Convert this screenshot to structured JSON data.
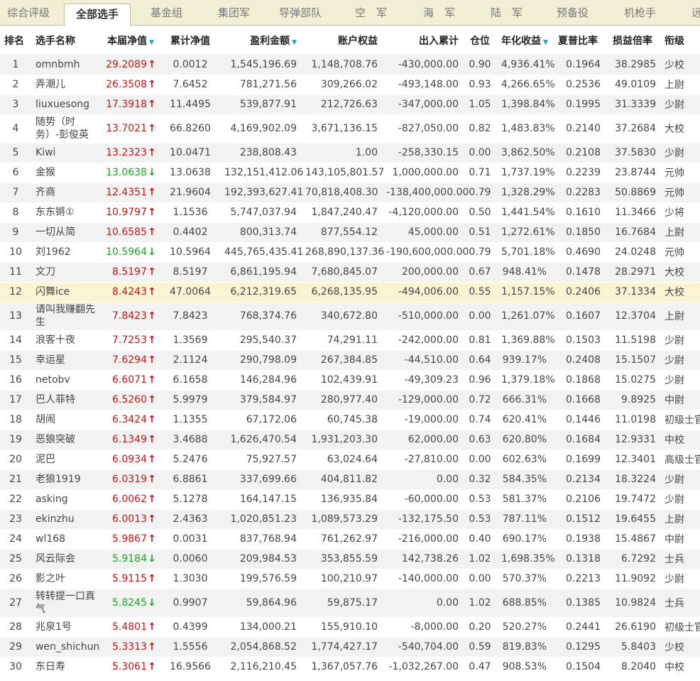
{
  "tabs": [
    "综合评级",
    "全部选手",
    "基金组",
    "集团军",
    "导弹部队",
    "空　军",
    "海　军",
    "陆　军",
    "预备役",
    "机枪手",
    "远"
  ],
  "columns": [
    "排名",
    "选手名称",
    "本届净值",
    "累计净值",
    "盈利金额",
    "账户权益",
    "出入累计",
    "仓位",
    "年化收益",
    "夏普比率",
    "损益倍率",
    "衔级"
  ],
  "rows": [
    {
      "rank": "1",
      "name": "omnbmh",
      "nav": "29.2089",
      "dir": "up",
      "cum": "0.0012",
      "profit": "1,545,196.69",
      "equity": "1,148,708.76",
      "flow": "-430,000.00",
      "pos": "0.90",
      "annual": "4,936.41%",
      "sharpe": "0.1964",
      "ratio": "38.2985",
      "grade": "少校"
    },
    {
      "rank": "2",
      "name": "弄潮儿",
      "nav": "26.3508",
      "dir": "up",
      "cum": "7.6452",
      "profit": "781,271.56",
      "equity": "309,266.02",
      "flow": "-493,148.00",
      "pos": "0.93",
      "annual": "4,266.65%",
      "sharpe": "0.2536",
      "ratio": "49.0109",
      "grade": "上尉"
    },
    {
      "rank": "3",
      "name": "liuxuesong",
      "nav": "17.3918",
      "dir": "up",
      "cum": "11.4495",
      "profit": "539,877.91",
      "equity": "212,726.63",
      "flow": "-347,000.00",
      "pos": "1.05",
      "annual": "1,398.84%",
      "sharpe": "0.1995",
      "ratio": "31.3339",
      "grade": "少尉"
    },
    {
      "rank": "4",
      "name": "随势（时务）-彭俊英",
      "nav": "13.7021",
      "dir": "up",
      "cum": "66.8260",
      "profit": "4,169,902.09",
      "equity": "3,671,136.15",
      "flow": "-827,050.00",
      "pos": "0.82",
      "annual": "1,483.83%",
      "sharpe": "0.2140",
      "ratio": "37.2684",
      "grade": "大校"
    },
    {
      "rank": "5",
      "name": "Kiwi",
      "nav": "13.2323",
      "dir": "up",
      "cum": "10.0471",
      "profit": "238,808.43",
      "equity": "1.00",
      "flow": "-258,330.15",
      "pos": "0.00",
      "annual": "3,862.50%",
      "sharpe": "0.2108",
      "ratio": "37.5830",
      "grade": "少尉"
    },
    {
      "rank": "6",
      "name": "金猴",
      "nav": "13.0638",
      "dir": "down",
      "cum": "13.0638",
      "profit": "132,151,412.06",
      "equity": "143,105,801.57",
      "flow": "1,000,000.00",
      "pos": "0.71",
      "annual": "1,737.19%",
      "sharpe": "0.2239",
      "ratio": "23.8744",
      "grade": "元帅"
    },
    {
      "rank": "7",
      "name": "齐商",
      "nav": "12.4351",
      "dir": "up",
      "cum": "21.9604",
      "profit": "192,393,627.41",
      "equity": "70,818,408.30",
      "flow": "-138,400,000.00",
      "pos": "0.79",
      "annual": "1,328.29%",
      "sharpe": "0.2283",
      "ratio": "50.8869",
      "grade": "元帅"
    },
    {
      "rank": "8",
      "name": "东东锵①",
      "nav": "10.9797",
      "dir": "up",
      "cum": "1.1536",
      "profit": "5,747,037.94",
      "equity": "1,847,240.47",
      "flow": "-4,120,000.00",
      "pos": "0.50",
      "annual": "1,441.54%",
      "sharpe": "0.1610",
      "ratio": "11.3466",
      "grade": "少将"
    },
    {
      "rank": "9",
      "name": "一切从简",
      "nav": "10.6585",
      "dir": "up",
      "cum": "0.4402",
      "profit": "800,313.74",
      "equity": "877,554.12",
      "flow": "45,000.00",
      "pos": "0.51",
      "annual": "1,272.61%",
      "sharpe": "0.1850",
      "ratio": "16.7684",
      "grade": "上尉"
    },
    {
      "rank": "10",
      "name": "刘1962",
      "nav": "10.5964",
      "dir": "down",
      "cum": "10.5964",
      "profit": "445,765,435.41",
      "equity": "268,890,137.36",
      "flow": "-190,600,000.00",
      "pos": "0.79",
      "annual": "5,701.18%",
      "sharpe": "0.4690",
      "ratio": "24.0248",
      "grade": "元帅"
    },
    {
      "rank": "11",
      "name": "文刀",
      "nav": "8.5197",
      "dir": "up",
      "cum": "8.5197",
      "profit": "6,861,195.94",
      "equity": "7,680,845.07",
      "flow": "200,000.00",
      "pos": "0.67",
      "annual": "948.41%",
      "sharpe": "0.1478",
      "ratio": "28.2971",
      "grade": "大校"
    },
    {
      "rank": "12",
      "name": "闪舞ice",
      "nav": "8.4243",
      "dir": "up",
      "cum": "47.0064",
      "profit": "6,212,319.65",
      "equity": "6,268,135.95",
      "flow": "-494,006.00",
      "pos": "0.55",
      "annual": "1,157.15%",
      "sharpe": "0.2406",
      "ratio": "37.1334",
      "grade": "大校"
    },
    {
      "rank": "13",
      "name": "请叫我赚翻先生",
      "nav": "7.8423",
      "dir": "up",
      "cum": "7.8423",
      "profit": "768,374.76",
      "equity": "340,672.80",
      "flow": "-510,000.00",
      "pos": "0.00",
      "annual": "1,261.07%",
      "sharpe": "0.1607",
      "ratio": "12.3704",
      "grade": "上尉"
    },
    {
      "rank": "14",
      "name": "浪客十夜",
      "nav": "7.7253",
      "dir": "up",
      "cum": "1.3569",
      "profit": "295,540.37",
      "equity": "74,291.11",
      "flow": "-242,000.00",
      "pos": "0.81",
      "annual": "1,369.88%",
      "sharpe": "0.1503",
      "ratio": "11.5198",
      "grade": "少尉"
    },
    {
      "rank": "15",
      "name": "幸运星",
      "nav": "7.6294",
      "dir": "up",
      "cum": "2.1124",
      "profit": "290,798.09",
      "equity": "267,384.85",
      "flow": "-44,510.00",
      "pos": "0.64",
      "annual": "939.17%",
      "sharpe": "0.2408",
      "ratio": "15.1507",
      "grade": "少尉"
    },
    {
      "rank": "16",
      "name": "netobv",
      "nav": "6.6071",
      "dir": "up",
      "cum": "6.1658",
      "profit": "146,284.96",
      "equity": "102,439.91",
      "flow": "-49,309.23",
      "pos": "0.96",
      "annual": "1,379.18%",
      "sharpe": "0.1868",
      "ratio": "15.0275",
      "grade": "少尉"
    },
    {
      "rank": "17",
      "name": "巴人菲特",
      "nav": "6.5260",
      "dir": "up",
      "cum": "5.9979",
      "profit": "379,584.97",
      "equity": "280,977.40",
      "flow": "-129,000.00",
      "pos": "0.72",
      "annual": "666.31%",
      "sharpe": "0.1668",
      "ratio": "9.8925",
      "grade": "中尉"
    },
    {
      "rank": "18",
      "name": "胡闹",
      "nav": "6.3424",
      "dir": "up",
      "cum": "1.1355",
      "profit": "67,172.06",
      "equity": "60,745.38",
      "flow": "-19,000.00",
      "pos": "0.74",
      "annual": "620.41%",
      "sharpe": "0.1446",
      "ratio": "11.0198",
      "grade": "初级士官"
    },
    {
      "rank": "19",
      "name": "恶狼突破",
      "nav": "6.1349",
      "dir": "up",
      "cum": "3.4688",
      "profit": "1,626,470.54",
      "equity": "1,931,203.30",
      "flow": "62,000.00",
      "pos": "0.63",
      "annual": "620.80%",
      "sharpe": "0.1684",
      "ratio": "12.9331",
      "grade": "中校"
    },
    {
      "rank": "20",
      "name": "泥巴",
      "nav": "6.0934",
      "dir": "up",
      "cum": "5.2476",
      "profit": "75,927.57",
      "equity": "63,024.64",
      "flow": "-27,810.00",
      "pos": "0.00",
      "annual": "602.63%",
      "sharpe": "0.1699",
      "ratio": "12.3401",
      "grade": "高级士官"
    },
    {
      "rank": "21",
      "name": "老狼1919",
      "nav": "6.0319",
      "dir": "up",
      "cum": "6.8861",
      "profit": "337,699.66",
      "equity": "404,811.82",
      "flow": "0.00",
      "pos": "0.32",
      "annual": "584.35%",
      "sharpe": "0.2134",
      "ratio": "18.3224",
      "grade": "少尉"
    },
    {
      "rank": "22",
      "name": "asking",
      "nav": "6.0062",
      "dir": "up",
      "cum": "5.1278",
      "profit": "164,147.15",
      "equity": "136,935.84",
      "flow": "-60,000.00",
      "pos": "0.53",
      "annual": "581.37%",
      "sharpe": "0.2106",
      "ratio": "19.7472",
      "grade": "少尉"
    },
    {
      "rank": "23",
      "name": "ekinzhu",
      "nav": "6.0013",
      "dir": "up",
      "cum": "2.4363",
      "profit": "1,020,851.23",
      "equity": "1,089,573.29",
      "flow": "-132,175.50",
      "pos": "0.53",
      "annual": "787.11%",
      "sharpe": "0.1512",
      "ratio": "19.6455",
      "grade": "上尉"
    },
    {
      "rank": "24",
      "name": "wl168",
      "nav": "5.9867",
      "dir": "up",
      "cum": "0.0031",
      "profit": "837,768.94",
      "equity": "761,262.97",
      "flow": "-216,000.00",
      "pos": "0.40",
      "annual": "690.17%",
      "sharpe": "0.1938",
      "ratio": "15.4867",
      "grade": "中尉"
    },
    {
      "rank": "25",
      "name": "风云际会",
      "nav": "5.9184",
      "dir": "down",
      "cum": "0.0060",
      "profit": "209,984.53",
      "equity": "353,855.59",
      "flow": "142,738.26",
      "pos": "1.02",
      "annual": "1,698.35%",
      "sharpe": "0.1318",
      "ratio": "6.7292",
      "grade": "士兵"
    },
    {
      "rank": "26",
      "name": "影之叶",
      "nav": "5.9115",
      "dir": "up",
      "cum": "1.3030",
      "profit": "199,576.59",
      "equity": "100,210.97",
      "flow": "-140,000.00",
      "pos": "0.00",
      "annual": "570.37%",
      "sharpe": "0.2213",
      "ratio": "11.9092",
      "grade": "少尉"
    },
    {
      "rank": "27",
      "name": "转转提一口真气",
      "nav": "5.8245",
      "dir": "down",
      "cum": "0.9907",
      "profit": "59,864.96",
      "equity": "59,875.17",
      "flow": "0.00",
      "pos": "1.02",
      "annual": "688.85%",
      "sharpe": "0.1385",
      "ratio": "10.9824",
      "grade": "士兵"
    },
    {
      "rank": "28",
      "name": "兆泉1号",
      "nav": "5.4801",
      "dir": "up",
      "cum": "0.4399",
      "profit": "134,000.21",
      "equity": "155,910.10",
      "flow": "-8,000.00",
      "pos": "0.20",
      "annual": "520.27%",
      "sharpe": "0.2441",
      "ratio": "26.6190",
      "grade": "初级士官"
    },
    {
      "rank": "29",
      "name": "wen_shichun",
      "nav": "5.3313",
      "dir": "up",
      "cum": "1.5556",
      "profit": "2,054,868.52",
      "equity": "1,774,427.17",
      "flow": "-540,704.00",
      "pos": "0.59",
      "annual": "819.83%",
      "sharpe": "0.1295",
      "ratio": "5.8403",
      "grade": "少校"
    },
    {
      "rank": "30",
      "name": "东日寿",
      "nav": "5.3061",
      "dir": "up",
      "cum": "16.9566",
      "profit": "2,116,210.45",
      "equity": "1,367,057.76",
      "flow": "-1,032,267.00",
      "pos": "0.47",
      "annual": "908.53%",
      "sharpe": "0.1504",
      "ratio": "8.2040",
      "grade": "中校"
    }
  ],
  "highlight_rank": "12",
  "tall_ranks": [
    "4",
    "13",
    "27"
  ],
  "icons": {
    "up": "red-up-arrow",
    "down": "green-down-arrow",
    "sort": "sort-desc-triangle"
  },
  "colors": {
    "up": "#cc1111",
    "down": "#17a81f",
    "sort": "#1c9ad6",
    "tab_bar": "#f3eed6",
    "highlight_row": "#fbf4d4"
  }
}
